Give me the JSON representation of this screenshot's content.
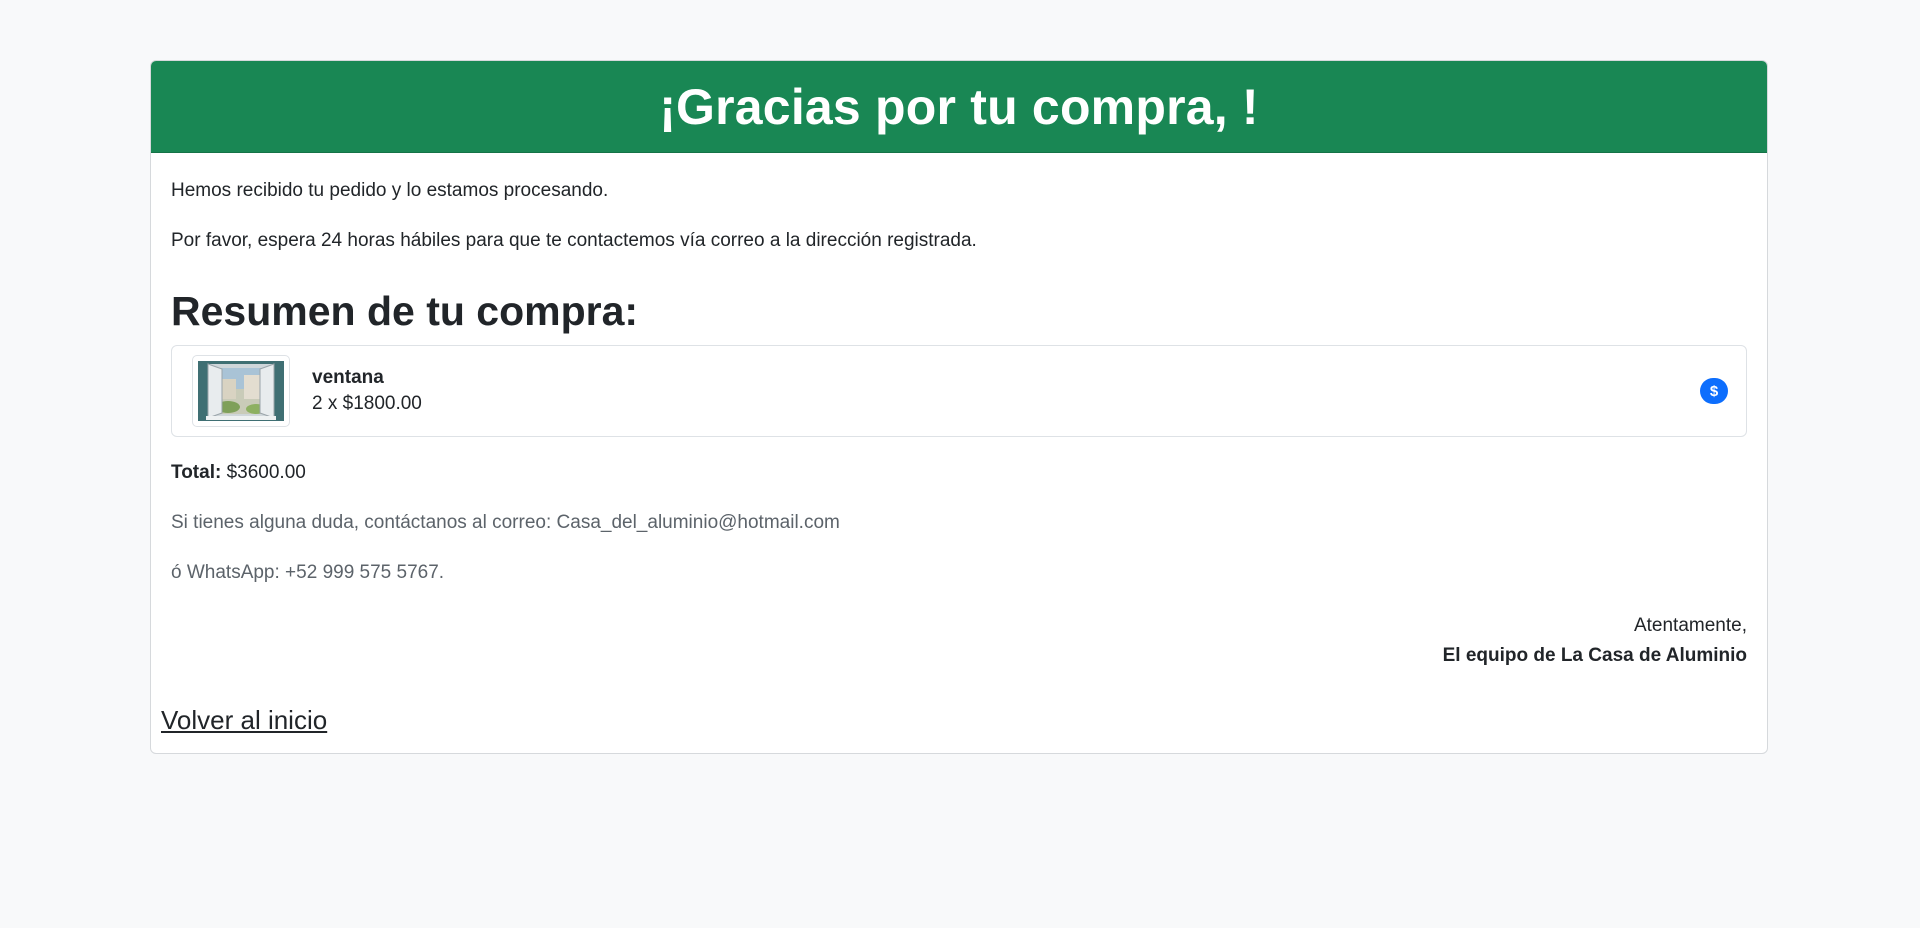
{
  "header": {
    "title": "¡Gracias por tu compra, !"
  },
  "messages": {
    "received": "Hemos recibido tu pedido y lo estamos procesando.",
    "wait": "Por favor, espera 24 horas hábiles para que te contactemos vía correo a la dirección registrada."
  },
  "summary": {
    "title": "Resumen de tu compra:",
    "items": [
      {
        "name": "ventana",
        "quantity_price": "2 x $1800.00",
        "badge": "$",
        "image_icon": "window-product-image"
      }
    ]
  },
  "total": {
    "label": "Total:",
    "value": "$3600.00"
  },
  "contact": {
    "email_line": "Si tienes alguna duda, contáctanos al correo: Casa_del_aluminio@hotmail.com",
    "whatsapp_line": "ó WhatsApp: +52 999 575 5767."
  },
  "signoff": {
    "closing": "Atentamente,",
    "team": "El equipo de La Casa de Aluminio"
  },
  "footer": {
    "back_link": "Volver al inicio"
  },
  "colors": {
    "header_bg": "#198754",
    "badge_bg": "#0d6efd",
    "page_bg": "#f8f9fa"
  }
}
